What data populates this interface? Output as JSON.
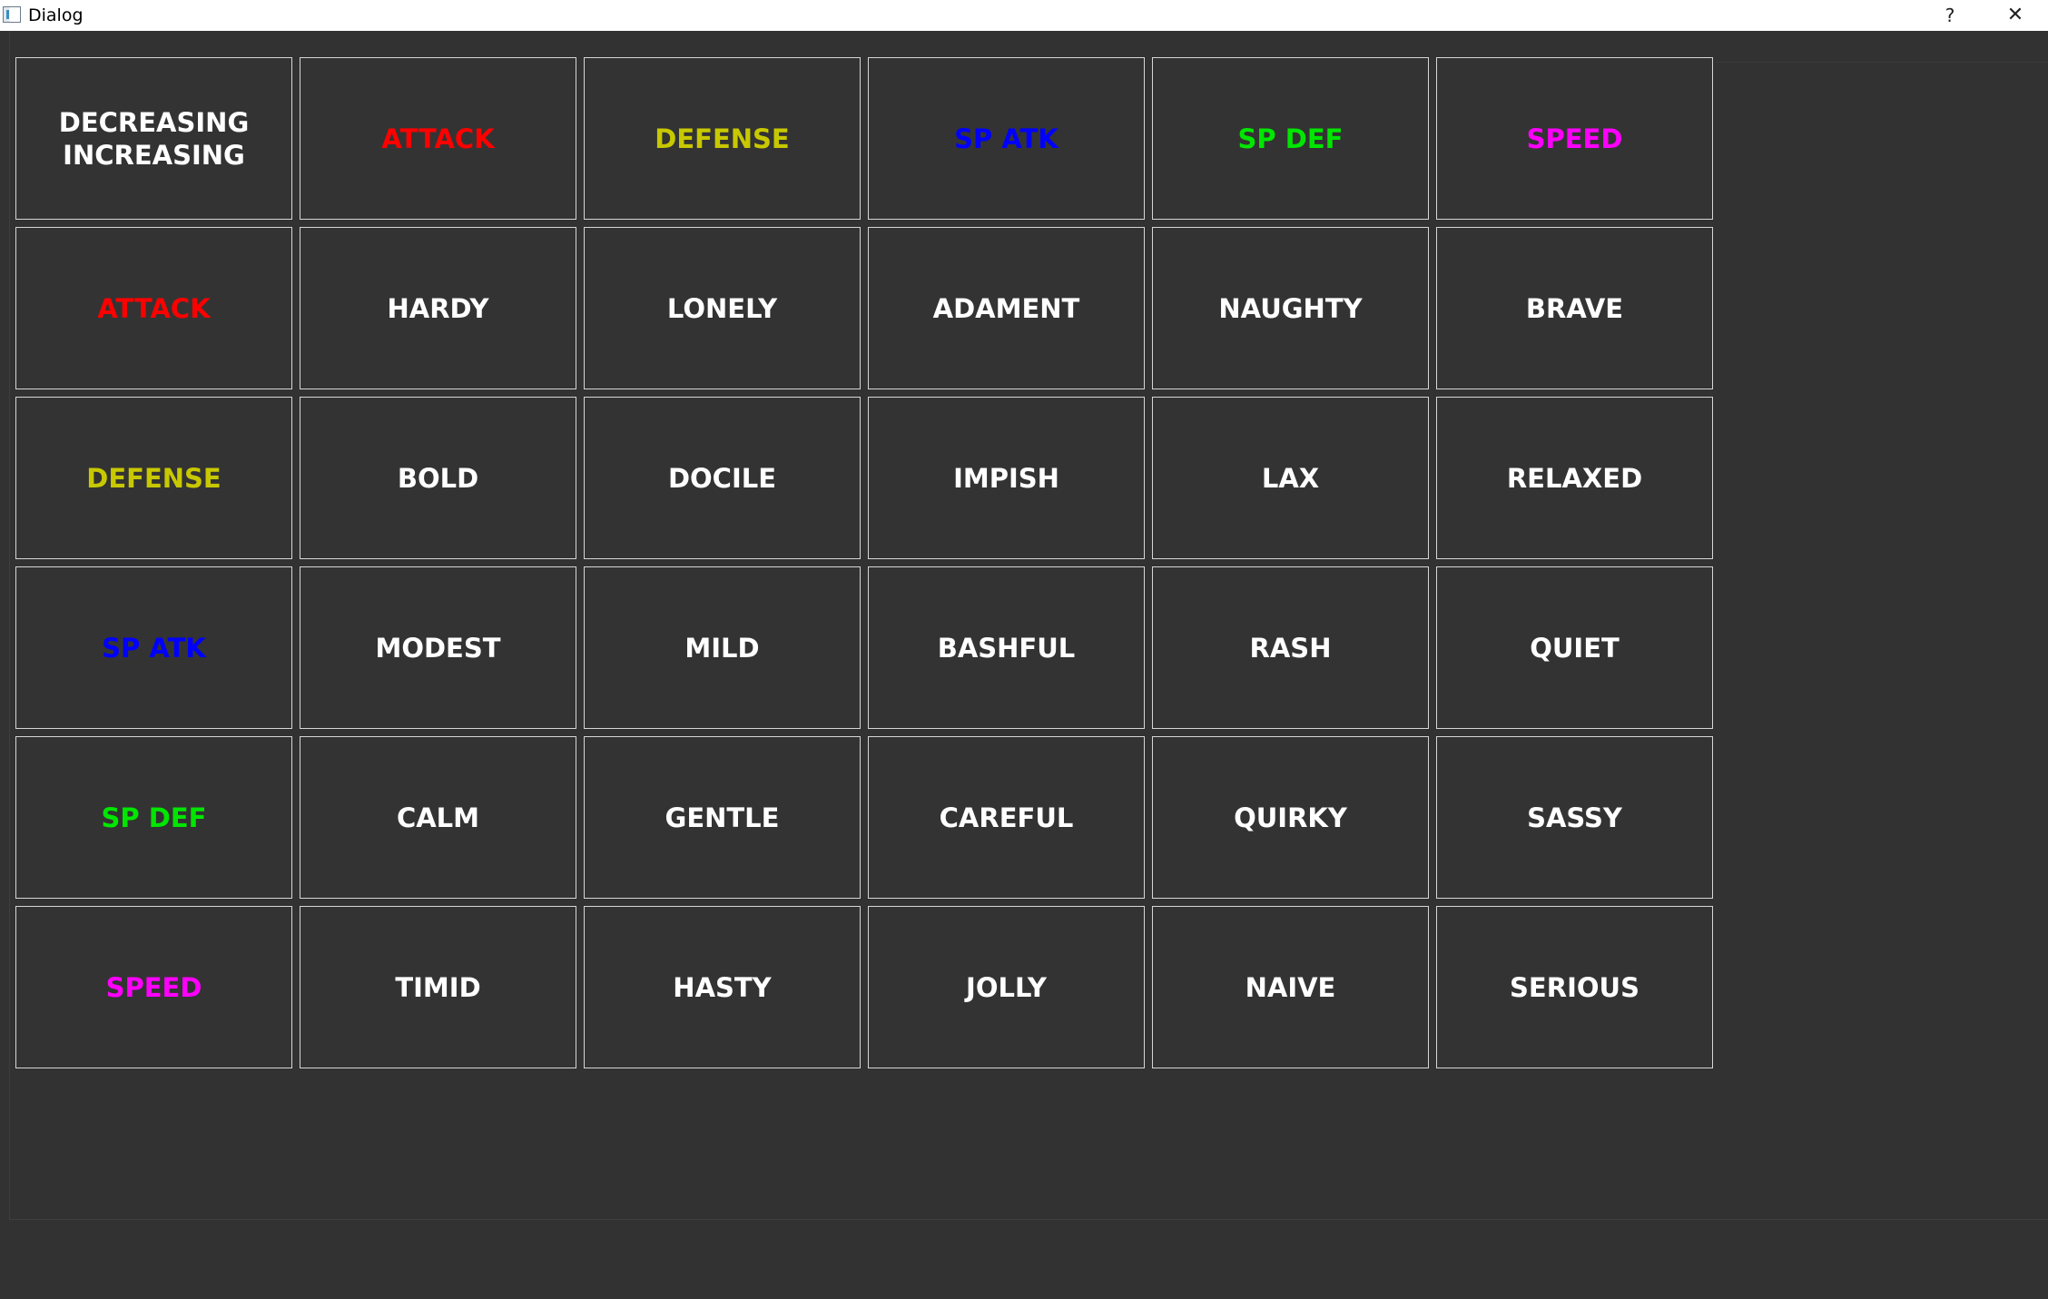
{
  "window": {
    "title": "Dialog",
    "help_label": "?",
    "close_label": "✕",
    "icon": "app-window-icon"
  },
  "colors": {
    "background": "#323232",
    "cell_border": "#d6d6d6",
    "text_default": "#ffffff",
    "attack": "#ff0000",
    "defense": "#c8c800",
    "sp_atk": "#0000ff",
    "sp_def": "#00e600",
    "speed": "#ff00ff"
  },
  "grid": {
    "rows": [
      [
        {
          "text": "DECREASING\nINCREASING",
          "color": "#ffffff"
        },
        {
          "text": "ATTACK",
          "color": "#ff0000"
        },
        {
          "text": "DEFENSE",
          "color": "#c8c800"
        },
        {
          "text": "SP ATK",
          "color": "#0000ff"
        },
        {
          "text": "SP DEF",
          "color": "#00e600"
        },
        {
          "text": "SPEED",
          "color": "#ff00ff"
        }
      ],
      [
        {
          "text": "ATTACK",
          "color": "#ff0000"
        },
        {
          "text": "HARDY",
          "color": "#ffffff"
        },
        {
          "text": "LONELY",
          "color": "#ffffff"
        },
        {
          "text": "ADAMENT",
          "color": "#ffffff"
        },
        {
          "text": "NAUGHTY",
          "color": "#ffffff"
        },
        {
          "text": "BRAVE",
          "color": "#ffffff"
        }
      ],
      [
        {
          "text": "DEFENSE",
          "color": "#c8c800"
        },
        {
          "text": "BOLD",
          "color": "#ffffff"
        },
        {
          "text": "DOCILE",
          "color": "#ffffff"
        },
        {
          "text": "IMPISH",
          "color": "#ffffff"
        },
        {
          "text": "LAX",
          "color": "#ffffff"
        },
        {
          "text": "RELAXED",
          "color": "#ffffff"
        }
      ],
      [
        {
          "text": "SP ATK",
          "color": "#0000ff"
        },
        {
          "text": "MODEST",
          "color": "#ffffff"
        },
        {
          "text": "MILD",
          "color": "#ffffff"
        },
        {
          "text": "BASHFUL",
          "color": "#ffffff"
        },
        {
          "text": "RASH",
          "color": "#ffffff"
        },
        {
          "text": "QUIET",
          "color": "#ffffff"
        }
      ],
      [
        {
          "text": "SP DEF",
          "color": "#00e600"
        },
        {
          "text": "CALM",
          "color": "#ffffff"
        },
        {
          "text": "GENTLE",
          "color": "#ffffff"
        },
        {
          "text": "CAREFUL",
          "color": "#ffffff"
        },
        {
          "text": "QUIRKY",
          "color": "#ffffff"
        },
        {
          "text": "SASSY",
          "color": "#ffffff"
        }
      ],
      [
        {
          "text": "SPEED",
          "color": "#ff00ff"
        },
        {
          "text": "TIMID",
          "color": "#ffffff"
        },
        {
          "text": "HASTY",
          "color": "#ffffff"
        },
        {
          "text": "JOLLY",
          "color": "#ffffff"
        },
        {
          "text": "NAIVE",
          "color": "#ffffff"
        },
        {
          "text": "SERIOUS",
          "color": "#ffffff"
        }
      ]
    ]
  }
}
